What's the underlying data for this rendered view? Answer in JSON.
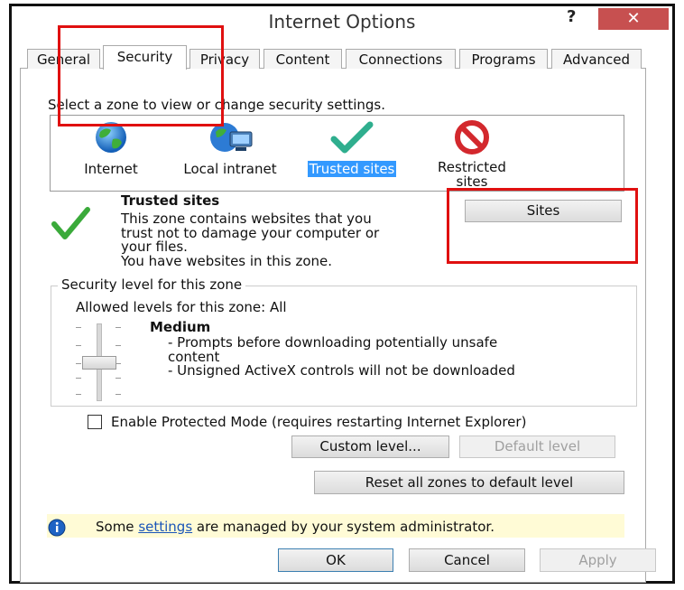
{
  "window": {
    "title": "Internet Options",
    "help": "?",
    "close": "✕"
  },
  "tabs": [
    {
      "label": "General"
    },
    {
      "label": "Security"
    },
    {
      "label": "Privacy"
    },
    {
      "label": "Content"
    },
    {
      "label": "Connections"
    },
    {
      "label": "Programs"
    },
    {
      "label": "Advanced"
    }
  ],
  "security": {
    "zone_prompt": "Select a zone to view or change security settings.",
    "zones": [
      {
        "label": "Internet",
        "icon": "globe-icon"
      },
      {
        "label": "Local intranet",
        "icon": "intranet-icon"
      },
      {
        "label": "Trusted sites",
        "icon": "checkmark-icon",
        "selected": true
      },
      {
        "label": "Restricted\nsites",
        "icon": "restricted-icon"
      }
    ],
    "zone_title": "Trusted sites",
    "zone_desc_1": "This zone contains websites that you",
    "zone_desc_2": "trust not to damage your computer or",
    "zone_desc_3": "your files.",
    "zone_desc_4": "You have websites in this zone.",
    "sites_button": "Sites",
    "level_group_label": "Security level for this zone",
    "allowed_levels": "Allowed levels for this zone: All",
    "level_name": "Medium",
    "level_desc_1": "- Prompts before downloading potentially unsafe",
    "level_desc_2": "content",
    "level_desc_3": "- Unsigned ActiveX controls will not be downloaded",
    "protected_mode_label": "Enable Protected Mode (requires restarting Internet Explorer)",
    "custom_level_button": "Custom level...",
    "default_level_button": "Default level",
    "reset_button": "Reset all zones to default level",
    "info_prefix": "Some ",
    "info_link": "settings",
    "info_suffix": " are managed by your system administrator."
  },
  "footer": {
    "ok": "OK",
    "cancel": "Cancel",
    "apply": "Apply"
  },
  "colors": {
    "highlight": "#3399ff",
    "close_button": "#c75050",
    "annotation_red": "#e01010",
    "info_bar": "#fffbd6"
  }
}
